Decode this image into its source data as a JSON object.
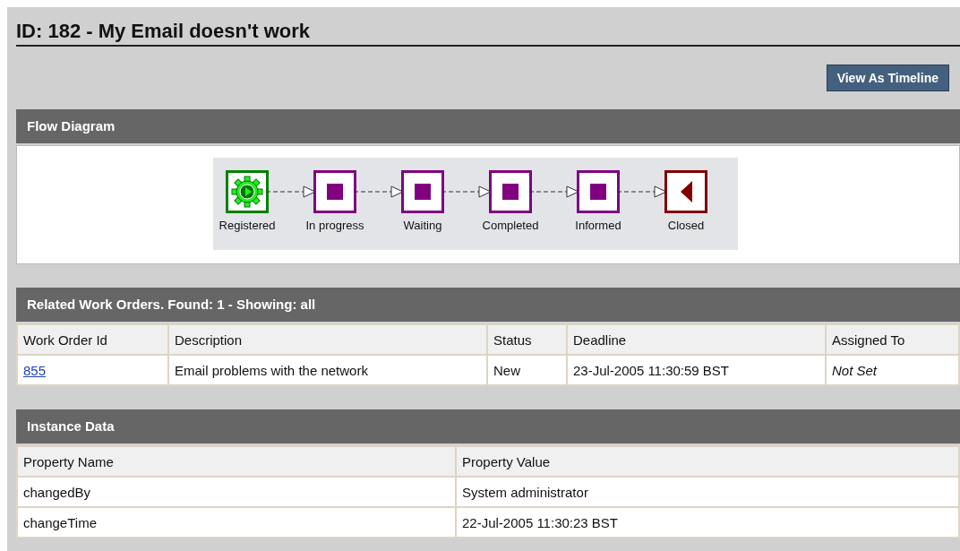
{
  "title": "ID: 182 - My Email doesn't work",
  "timeline_button": "View As Timeline",
  "flow": {
    "heading": "Flow Diagram",
    "nodes": [
      {
        "label": "Registered",
        "kind": "start"
      },
      {
        "label": "In progress",
        "kind": "step"
      },
      {
        "label": "Waiting",
        "kind": "step"
      },
      {
        "label": "Completed",
        "kind": "step"
      },
      {
        "label": "Informed",
        "kind": "step"
      },
      {
        "label": "Closed",
        "kind": "end"
      }
    ]
  },
  "work_orders": {
    "heading": "Related Work Orders. Found: 1 - Showing: all",
    "columns": [
      "Work Order Id",
      "Description",
      "Status",
      "Deadline",
      "Assigned To"
    ],
    "rows": [
      {
        "id": "855",
        "description": "Email problems with the network",
        "status": "New",
        "deadline": "23-Jul-2005 11:30:59 BST",
        "assigned_to": "Not Set",
        "assigned_set": false
      }
    ]
  },
  "instance_data": {
    "heading": "Instance Data",
    "columns": [
      "Property Name",
      "Property Value"
    ],
    "rows": [
      {
        "name": "changedBy",
        "value": "System administrator"
      },
      {
        "name": "changeTime",
        "value": "22-Jul-2005 11:30:23 BST"
      }
    ]
  }
}
